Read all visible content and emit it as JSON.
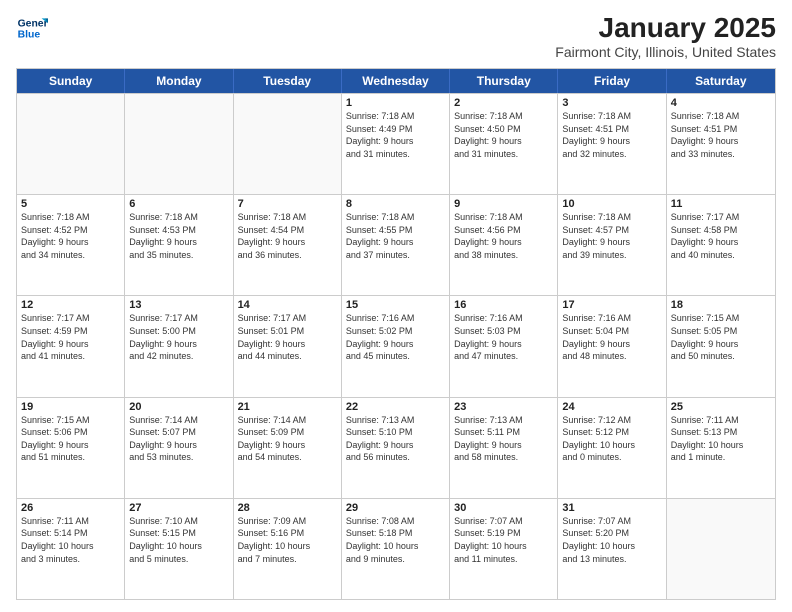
{
  "header": {
    "logo_line1": "General",
    "logo_line2": "Blue",
    "title": "January 2025",
    "subtitle": "Fairmont City, Illinois, United States"
  },
  "calendar": {
    "days_of_week": [
      "Sunday",
      "Monday",
      "Tuesday",
      "Wednesday",
      "Thursday",
      "Friday",
      "Saturday"
    ],
    "weeks": [
      [
        {
          "day": "",
          "info": "",
          "empty": true
        },
        {
          "day": "",
          "info": "",
          "empty": true
        },
        {
          "day": "",
          "info": "",
          "empty": true
        },
        {
          "day": "1",
          "info": "Sunrise: 7:18 AM\nSunset: 4:49 PM\nDaylight: 9 hours\nand 31 minutes.",
          "empty": false
        },
        {
          "day": "2",
          "info": "Sunrise: 7:18 AM\nSunset: 4:50 PM\nDaylight: 9 hours\nand 31 minutes.",
          "empty": false
        },
        {
          "day": "3",
          "info": "Sunrise: 7:18 AM\nSunset: 4:51 PM\nDaylight: 9 hours\nand 32 minutes.",
          "empty": false
        },
        {
          "day": "4",
          "info": "Sunrise: 7:18 AM\nSunset: 4:51 PM\nDaylight: 9 hours\nand 33 minutes.",
          "empty": false
        }
      ],
      [
        {
          "day": "5",
          "info": "Sunrise: 7:18 AM\nSunset: 4:52 PM\nDaylight: 9 hours\nand 34 minutes.",
          "empty": false
        },
        {
          "day": "6",
          "info": "Sunrise: 7:18 AM\nSunset: 4:53 PM\nDaylight: 9 hours\nand 35 minutes.",
          "empty": false
        },
        {
          "day": "7",
          "info": "Sunrise: 7:18 AM\nSunset: 4:54 PM\nDaylight: 9 hours\nand 36 minutes.",
          "empty": false
        },
        {
          "day": "8",
          "info": "Sunrise: 7:18 AM\nSunset: 4:55 PM\nDaylight: 9 hours\nand 37 minutes.",
          "empty": false
        },
        {
          "day": "9",
          "info": "Sunrise: 7:18 AM\nSunset: 4:56 PM\nDaylight: 9 hours\nand 38 minutes.",
          "empty": false
        },
        {
          "day": "10",
          "info": "Sunrise: 7:18 AM\nSunset: 4:57 PM\nDaylight: 9 hours\nand 39 minutes.",
          "empty": false
        },
        {
          "day": "11",
          "info": "Sunrise: 7:17 AM\nSunset: 4:58 PM\nDaylight: 9 hours\nand 40 minutes.",
          "empty": false
        }
      ],
      [
        {
          "day": "12",
          "info": "Sunrise: 7:17 AM\nSunset: 4:59 PM\nDaylight: 9 hours\nand 41 minutes.",
          "empty": false
        },
        {
          "day": "13",
          "info": "Sunrise: 7:17 AM\nSunset: 5:00 PM\nDaylight: 9 hours\nand 42 minutes.",
          "empty": false
        },
        {
          "day": "14",
          "info": "Sunrise: 7:17 AM\nSunset: 5:01 PM\nDaylight: 9 hours\nand 44 minutes.",
          "empty": false
        },
        {
          "day": "15",
          "info": "Sunrise: 7:16 AM\nSunset: 5:02 PM\nDaylight: 9 hours\nand 45 minutes.",
          "empty": false
        },
        {
          "day": "16",
          "info": "Sunrise: 7:16 AM\nSunset: 5:03 PM\nDaylight: 9 hours\nand 47 minutes.",
          "empty": false
        },
        {
          "day": "17",
          "info": "Sunrise: 7:16 AM\nSunset: 5:04 PM\nDaylight: 9 hours\nand 48 minutes.",
          "empty": false
        },
        {
          "day": "18",
          "info": "Sunrise: 7:15 AM\nSunset: 5:05 PM\nDaylight: 9 hours\nand 50 minutes.",
          "empty": false
        }
      ],
      [
        {
          "day": "19",
          "info": "Sunrise: 7:15 AM\nSunset: 5:06 PM\nDaylight: 9 hours\nand 51 minutes.",
          "empty": false
        },
        {
          "day": "20",
          "info": "Sunrise: 7:14 AM\nSunset: 5:07 PM\nDaylight: 9 hours\nand 53 minutes.",
          "empty": false
        },
        {
          "day": "21",
          "info": "Sunrise: 7:14 AM\nSunset: 5:09 PM\nDaylight: 9 hours\nand 54 minutes.",
          "empty": false
        },
        {
          "day": "22",
          "info": "Sunrise: 7:13 AM\nSunset: 5:10 PM\nDaylight: 9 hours\nand 56 minutes.",
          "empty": false
        },
        {
          "day": "23",
          "info": "Sunrise: 7:13 AM\nSunset: 5:11 PM\nDaylight: 9 hours\nand 58 minutes.",
          "empty": false
        },
        {
          "day": "24",
          "info": "Sunrise: 7:12 AM\nSunset: 5:12 PM\nDaylight: 10 hours\nand 0 minutes.",
          "empty": false
        },
        {
          "day": "25",
          "info": "Sunrise: 7:11 AM\nSunset: 5:13 PM\nDaylight: 10 hours\nand 1 minute.",
          "empty": false
        }
      ],
      [
        {
          "day": "26",
          "info": "Sunrise: 7:11 AM\nSunset: 5:14 PM\nDaylight: 10 hours\nand 3 minutes.",
          "empty": false
        },
        {
          "day": "27",
          "info": "Sunrise: 7:10 AM\nSunset: 5:15 PM\nDaylight: 10 hours\nand 5 minutes.",
          "empty": false
        },
        {
          "day": "28",
          "info": "Sunrise: 7:09 AM\nSunset: 5:16 PM\nDaylight: 10 hours\nand 7 minutes.",
          "empty": false
        },
        {
          "day": "29",
          "info": "Sunrise: 7:08 AM\nSunset: 5:18 PM\nDaylight: 10 hours\nand 9 minutes.",
          "empty": false
        },
        {
          "day": "30",
          "info": "Sunrise: 7:07 AM\nSunset: 5:19 PM\nDaylight: 10 hours\nand 11 minutes.",
          "empty": false
        },
        {
          "day": "31",
          "info": "Sunrise: 7:07 AM\nSunset: 5:20 PM\nDaylight: 10 hours\nand 13 minutes.",
          "empty": false
        },
        {
          "day": "",
          "info": "",
          "empty": true
        }
      ]
    ]
  }
}
